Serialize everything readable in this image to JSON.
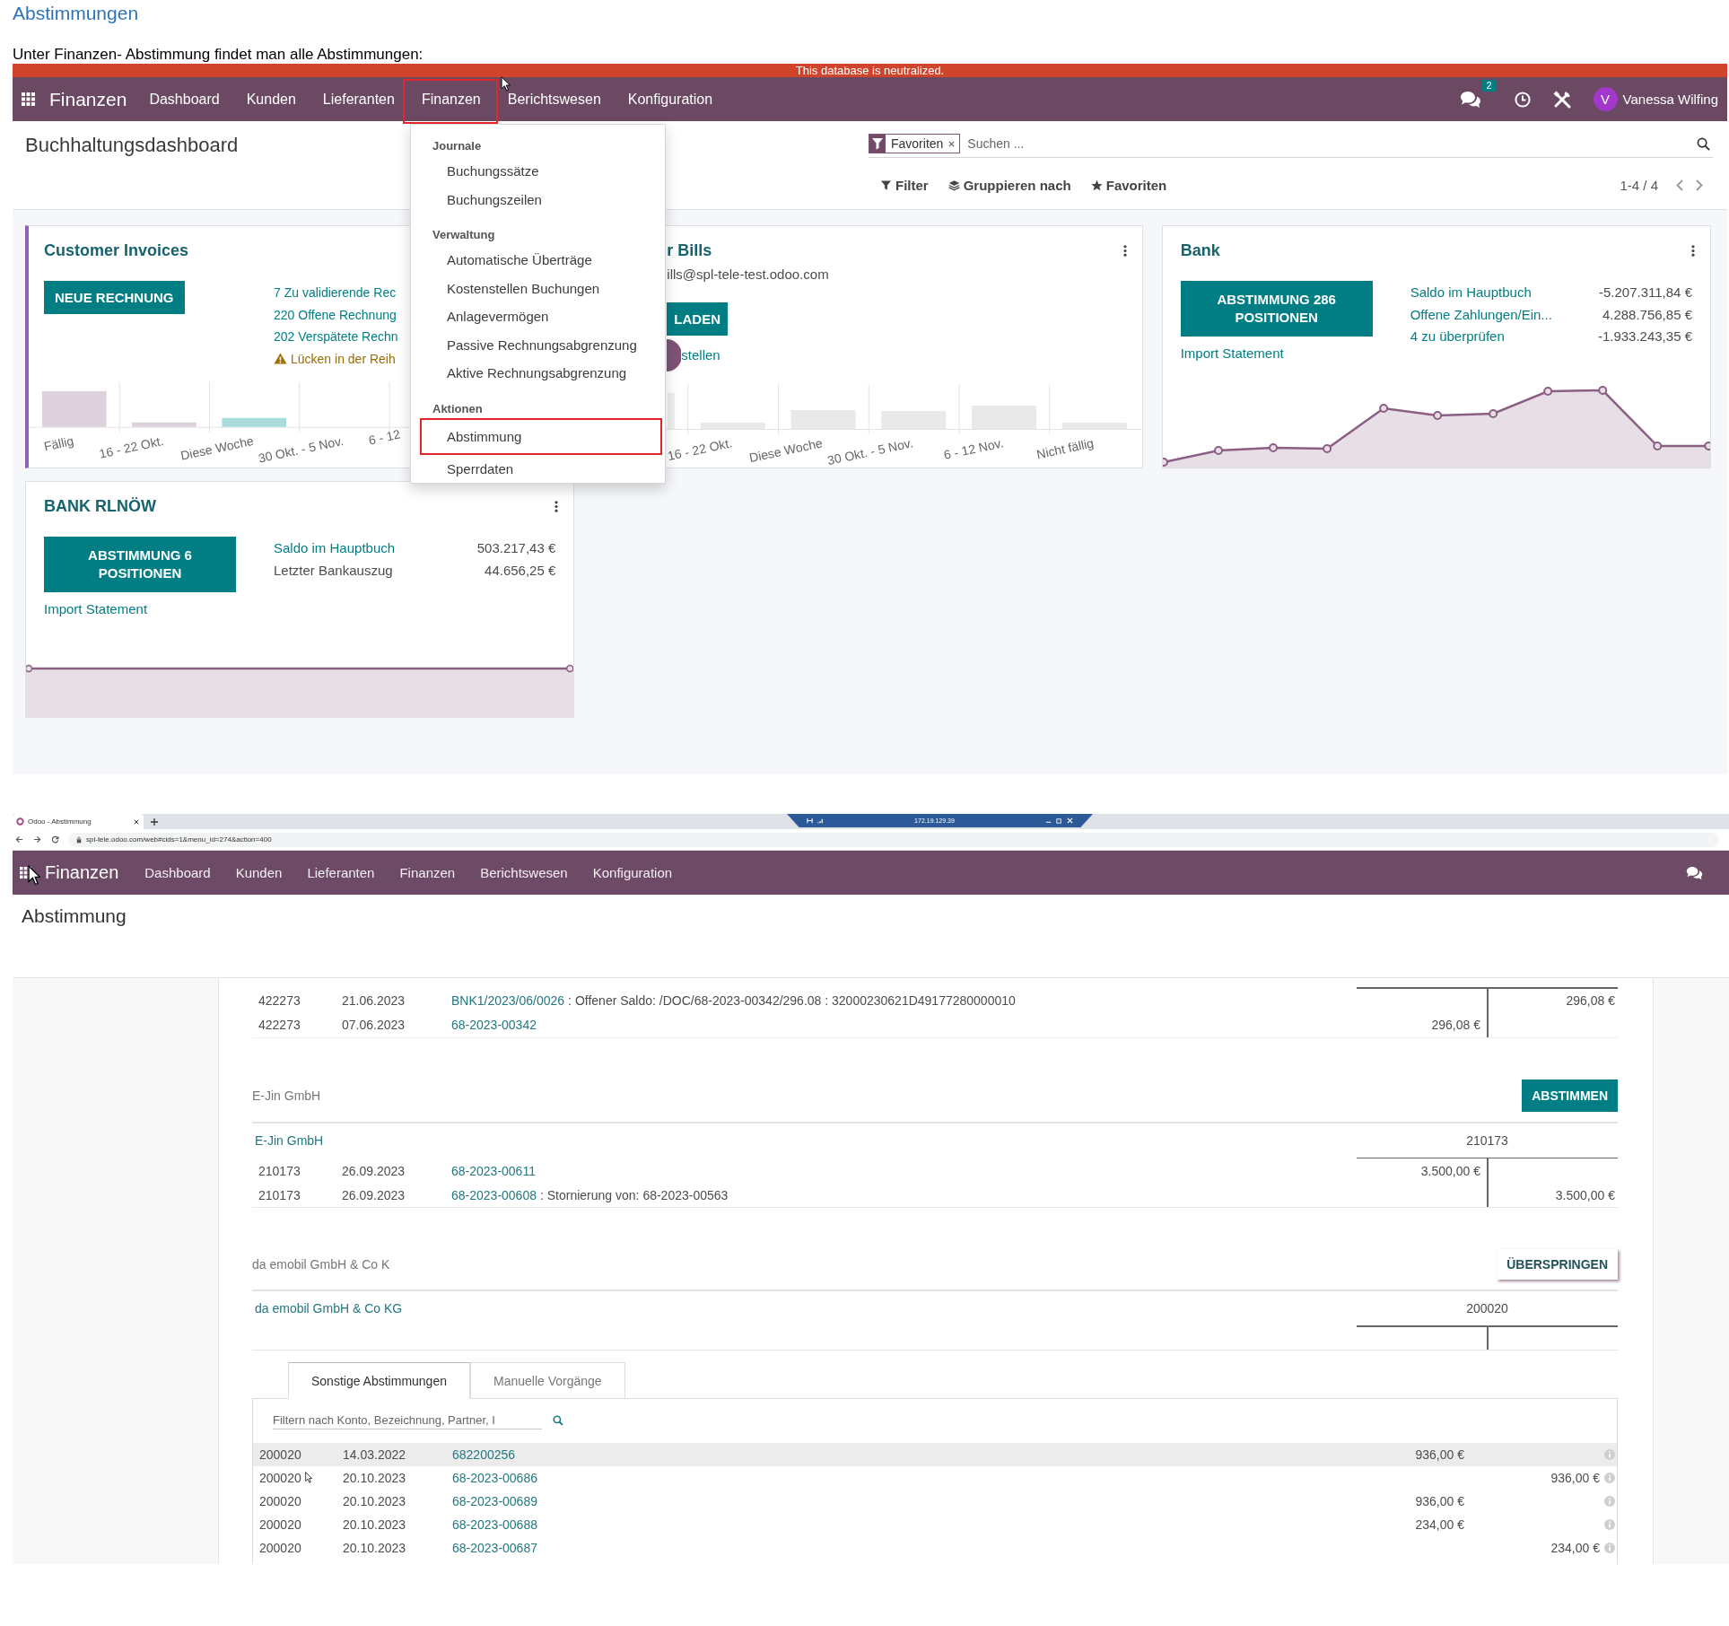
{
  "document": {
    "heading": "Abstimmungen",
    "intro": "Unter Finanzen- Abstimmung findet man alle Abstimmungen:"
  },
  "dashboard_screen": {
    "banner": "This database is neutralized.",
    "navbar": {
      "brand": "Finanzen",
      "menu": [
        {
          "label": "Dashboard",
          "highlighted": false
        },
        {
          "label": "Kunden",
          "highlighted": false
        },
        {
          "label": "Lieferanten",
          "highlighted": false
        },
        {
          "label": "Finanzen",
          "highlighted": true
        },
        {
          "label": "Berichtswesen",
          "highlighted": false
        },
        {
          "label": "Konfiguration",
          "highlighted": false
        }
      ],
      "chat_count": "2",
      "user": {
        "initial": "V",
        "name": "Vanessa Wilfing"
      }
    },
    "title": "Buchhaltungsdashboard",
    "search": {
      "facet": "Favoriten",
      "placeholder": "Suchen ..."
    },
    "toolbar": [
      {
        "kind": "filter",
        "label": "Filter"
      },
      {
        "kind": "group",
        "label": "Gruppieren nach"
      },
      {
        "kind": "favorites",
        "label": "Favoriten"
      }
    ],
    "pager": "1-4 / 4",
    "cards": [
      {
        "kind": "sales",
        "title": "Customer Invoices",
        "button": "NEUE RECHNUNG",
        "links": [
          {
            "label": "7 Zu validierende Rec",
            "warning": false
          },
          {
            "label": "220 Offene Rechnung",
            "warning": false
          },
          {
            "label": "202 Verspätete Rechn",
            "warning": false
          },
          {
            "label": "Lücken in der Reih",
            "warning": true
          }
        ],
        "chart": {
          "kind": "bars",
          "labels": [
            "Fällig",
            "16 - 22 Okt.",
            "Diese Woche",
            "30 Okt. - 5 Nov.",
            "6 - 12"
          ]
        }
      },
      {
        "kind": "purchase",
        "title": "r Bills",
        "email": "ills@spl-tele-test.odoo.com",
        "button": "LADEN",
        "links": [
          {
            "label": "stellen",
            "warning": false
          }
        ],
        "chart": {
          "kind": "bars",
          "labels": [
            "16 - 22 Okt.",
            "Diese Woche",
            "30 Okt. - 5 Nov.",
            "6 - 12 Nov.",
            "Nicht fällig"
          ]
        }
      },
      {
        "kind": "bank",
        "title": "Bank",
        "button": "ABSTIMMUNG 286 POSITIONEN",
        "import_link": "Import Statement",
        "balances": [
          {
            "label": "Saldo im Hauptbuch",
            "value": "-5.207.311,84 €",
            "link": true
          },
          {
            "label": "Offene Zahlungen/Ein...",
            "value": "4.288.756,85 €",
            "link": true
          },
          {
            "label": "4 zu überprüfen",
            "value": "-1.933.243,35 €",
            "link": true
          }
        ],
        "chart": {
          "kind": "trend"
        }
      },
      {
        "kind": "bank",
        "title": "BANK RLNÖW",
        "button": "ABSTIMMUNG 6 POSITIONEN",
        "import_link": "Import Statement",
        "balances": [
          {
            "label": "Saldo im Hauptbuch",
            "value": "503.217,43 €",
            "link": true
          },
          {
            "label": "Letzter Bankauszug",
            "value": "44.656,25 €",
            "link": false
          }
        ],
        "chart": {
          "kind": "flat"
        }
      }
    ],
    "menu_dropdown": {
      "sections": [
        {
          "header": "Journale",
          "items": [
            {
              "label": "Buchungssätze",
              "highlighted": false
            },
            {
              "label": "Buchungszeilen",
              "highlighted": false
            }
          ]
        },
        {
          "header": "Verwaltung",
          "items": [
            {
              "label": "Automatische Überträge",
              "highlighted": false
            },
            {
              "label": "Kostenstellen Buchungen",
              "highlighted": false
            },
            {
              "label": "Anlagevermögen",
              "highlighted": false
            },
            {
              "label": "Passive Rechnungsabgrenzung",
              "highlighted": false
            },
            {
              "label": "Aktive Rechnungsabgrenzung",
              "highlighted": false
            }
          ]
        },
        {
          "header": "Aktionen",
          "items": [
            {
              "label": "Abstimmung",
              "highlighted": true
            },
            {
              "label": "Sperrdaten",
              "highlighted": false
            }
          ]
        }
      ]
    }
  },
  "reconciliation_screen": {
    "browser": {
      "tab_title": "Odoo - Abstimmung",
      "remote_host": "172.19.129.39",
      "url": "spl-tele.odoo.com/web#cids=1&menu_id=274&action=400"
    },
    "navbar": {
      "brand": "Finanzen",
      "menu": [
        "Dashboard",
        "Kunden",
        "Lieferanten",
        "Finanzen",
        "Berichtswesen",
        "Konfiguration"
      ]
    },
    "title": "Abstimmung",
    "open_lines": [
      {
        "account": "422273",
        "date": "21.06.2023",
        "reference": "BNK1/2023/06/0026",
        "label": ": Offener Saldo: /DOC/68-2023-00342/296.08 : 32000230621D49177280000010",
        "credit": "296,08 €"
      },
      {
        "account": "422273",
        "date": "07.06.2023",
        "reference": "68-2023-00342",
        "debit": "296,08 €"
      }
    ],
    "partners": [
      {
        "caption": "E-Jin GmbH",
        "action": {
          "kind": "primary",
          "label": "ABSTIMMEN"
        },
        "name": "E-Jin GmbH",
        "account": "210173",
        "lines": [
          {
            "account": "210173",
            "date": "26.09.2023",
            "reference": "68-2023-00611",
            "debit": "3.500,00 €"
          },
          {
            "account": "210173",
            "date": "26.09.2023",
            "reference": "68-2023-00608",
            "label": ": Stornierung von: 68-2023-00563",
            "credit": "3.500,00 €"
          }
        ]
      },
      {
        "caption": "da emobil GmbH & Co K",
        "action": {
          "kind": "secondary",
          "label": "ÜBERSPRINGEN"
        },
        "name": "da emobil GmbH & Co KG",
        "account": "200020"
      }
    ],
    "tabs": [
      {
        "label": "Sonstige Abstimmungen",
        "selected": true
      },
      {
        "label": "Manuelle Vorgänge",
        "selected": false
      }
    ],
    "filter": {
      "placeholder": "Filtern nach Konto, Bezeichnung, Partner, I"
    },
    "rows": [
      {
        "account": "200020",
        "date": "14.03.2022",
        "reference": "682200256",
        "debit": "936,00 €",
        "selected": true
      },
      {
        "account": "200020",
        "date": "20.10.2023",
        "reference": "68-2023-00686",
        "credit": "936,00 €",
        "selected": false
      },
      {
        "account": "200020",
        "date": "20.10.2023",
        "reference": "68-2023-00689",
        "debit": "936,00 €",
        "selected": false
      },
      {
        "account": "200020",
        "date": "20.10.2023",
        "reference": "68-2023-00688",
        "debit": "234,00 €",
        "selected": false
      },
      {
        "account": "200020",
        "date": "20.10.2023",
        "reference": "68-2023-00687",
        "credit": "234,00 €",
        "selected": false
      }
    ]
  }
}
